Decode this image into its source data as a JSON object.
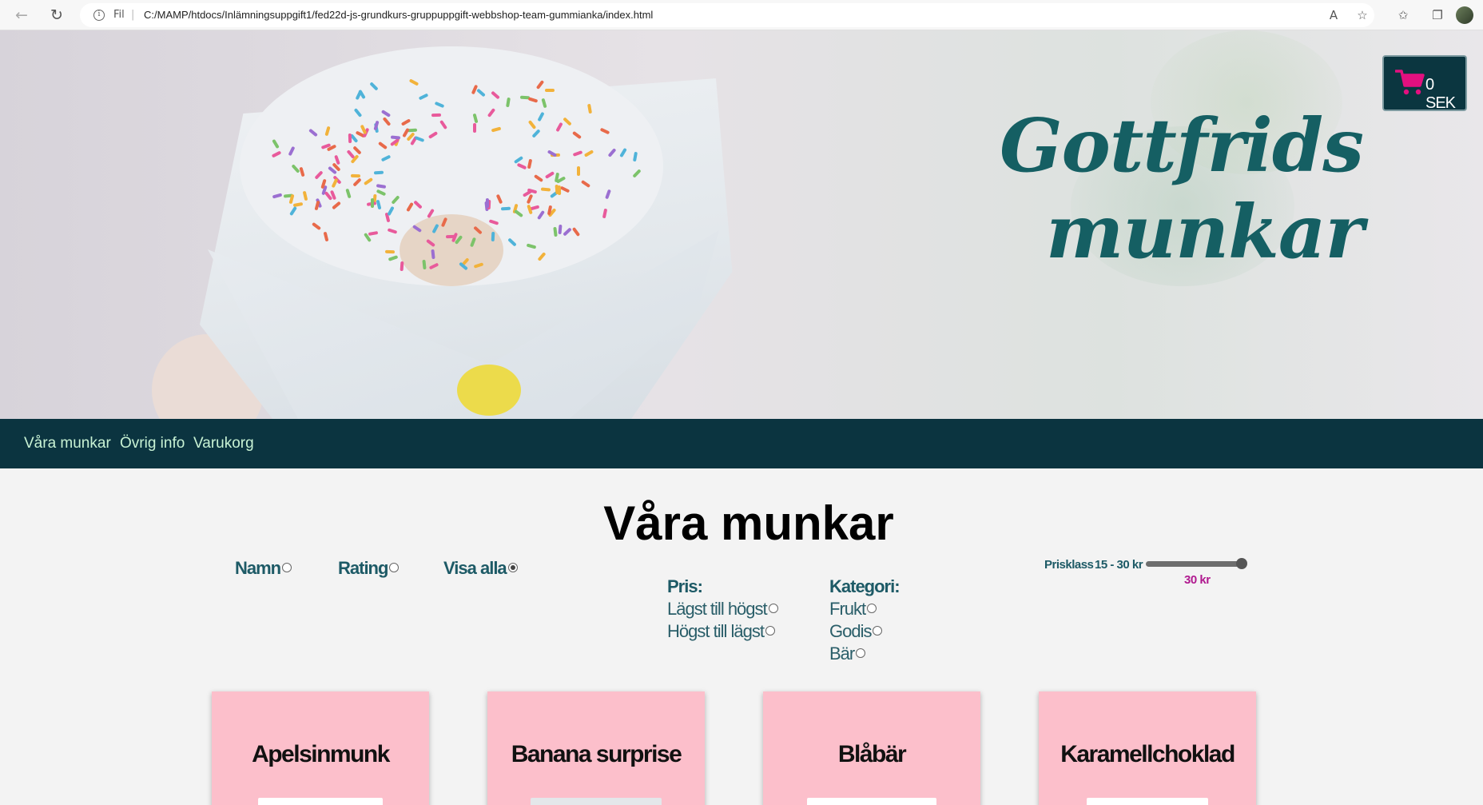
{
  "browser": {
    "security_label": "Fil",
    "url": "C:/MAMP/htdocs/Inlämningsuppgift1/fed22d-js-grundkurs-gruppuppgift-webbshop-team-gummianka/index.html"
  },
  "header": {
    "title_line1": "Gottfrids",
    "title_line2": "munkar",
    "cart_total": "0 SEK"
  },
  "nav": {
    "items": [
      "Våra munkar",
      "Övrig info",
      "Varukorg"
    ]
  },
  "main": {
    "heading": "Våra munkar",
    "sort": {
      "options": [
        {
          "label": "Namn",
          "checked": false
        },
        {
          "label": "Rating",
          "checked": false
        },
        {
          "label": "Visa alla",
          "checked": true
        }
      ]
    },
    "price_sort": {
      "heading": "Pris:",
      "options": [
        "Lägst till högst",
        "Högst till lägst"
      ]
    },
    "category": {
      "heading": "Kategori:",
      "options": [
        "Frukt",
        "Godis",
        "Bär"
      ]
    },
    "price_filter": {
      "label": "Prisklass",
      "range": "15 - 30 kr",
      "min": 15,
      "max": 30,
      "value": 30,
      "value_label": "30 kr"
    },
    "products": [
      {
        "name": "Apelsinmunk"
      },
      {
        "name": "Banana surprise"
      },
      {
        "name": "Blåbär"
      },
      {
        "name": "Karamellchoklad"
      }
    ]
  },
  "colors": {
    "nav_bg": "#0b3440",
    "nav_link": "#c8f2d4",
    "title": "#155f63",
    "accent": "#b0198f",
    "card_bg": "#fcbfcb",
    "cart_icon": "#e3107f"
  }
}
